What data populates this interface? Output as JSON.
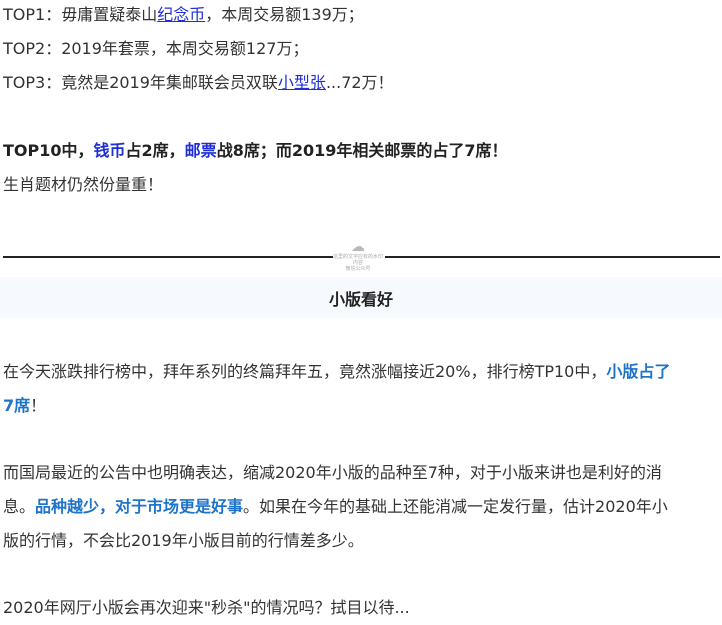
{
  "top_list": {
    "top1": {
      "prefix": "TOP1：毋庸置疑泰山",
      "link": "纪念币",
      "suffix": "，本周交易额139万；"
    },
    "top2": {
      "text": "TOP2：2019年套票，本周交易额127万；"
    },
    "top3": {
      "prefix": "TOP3：竟然是2019年集邮联会员双联",
      "link": "小型张",
      "suffix": "...72万！"
    }
  },
  "summary": {
    "part1": "TOP10中，",
    "link1": "钱币",
    "part2": "占2席，",
    "link2": "邮票",
    "part3": "战8席；而2019年相关邮票的占了7席！",
    "note": "生肖题材仍然份量重！"
  },
  "watermark": {
    "line1": "这里的文字应有的水印内容",
    "line2": "微信公众号"
  },
  "section": {
    "title": "小版看好"
  },
  "paragraphs": {
    "p1_text": "在今天涨跌排行榜中，拜年系列的终篇拜年五，竟然涨幅接近20%，排行榜TP10中，",
    "p1_highlight_a": "小版占了",
    "p1_highlight_b": "7席",
    "p1_end": "！",
    "p2_text_a": "而国局最近的公告中也明确表达，缩减2020年小版的品种至7种，对于小版来讲也是利好的消",
    "p2_text_b": "息。",
    "p2_highlight": "品种越少，对于市场更是好事",
    "p2_text_c": "。如果在今年的基础上还能消减一定发行量，估计2020年小",
    "p2_text_d": "版的行情，不会比2019年小版目前的行情差多少。",
    "p3_text": "2020年网厅小版会再次迎来\"秒杀\"的情况吗？拭目以待..."
  }
}
